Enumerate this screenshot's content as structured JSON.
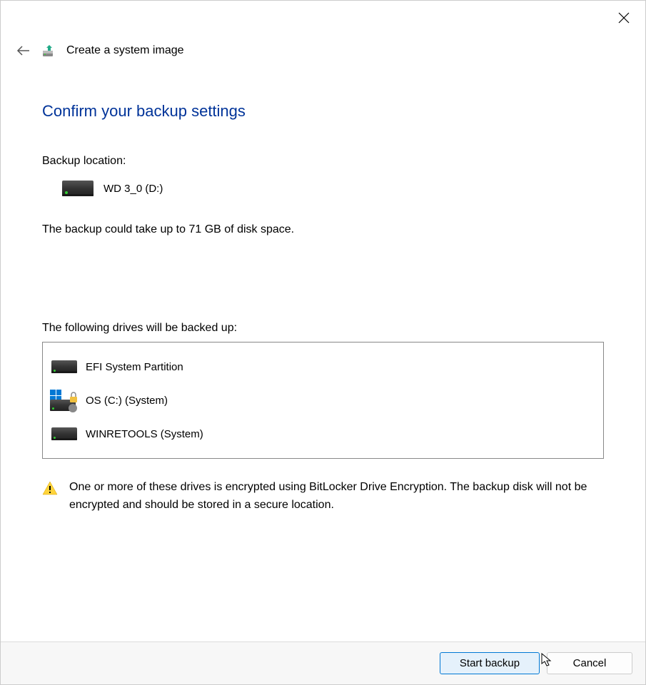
{
  "window": {
    "title": "Create a system image"
  },
  "page": {
    "heading": "Confirm your backup settings",
    "backup_location_label": "Backup location:",
    "backup_location_value": "WD 3_0 (D:)",
    "size_note": "The backup could take up to 71 GB of disk space.",
    "drives_label": "The following drives will be backed up:",
    "drives": [
      {
        "label": "EFI System Partition",
        "icon": "drive"
      },
      {
        "label": "OS (C:) (System)",
        "icon": "os-locked"
      },
      {
        "label": "WINRETOOLS (System)",
        "icon": "drive"
      }
    ],
    "warning": "One or more of these drives is encrypted using BitLocker Drive Encryption. The backup disk will not be encrypted and should be stored in a secure location."
  },
  "buttons": {
    "start": "Start backup",
    "cancel": "Cancel"
  }
}
